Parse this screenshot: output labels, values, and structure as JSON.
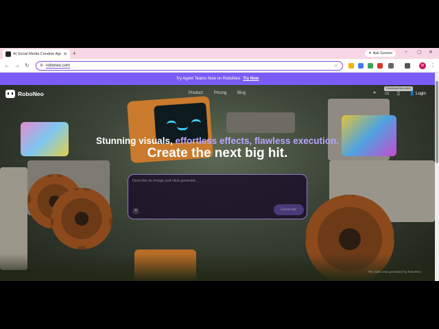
{
  "browser": {
    "tab_title": "AI Social Media Creative Agent",
    "ask_label": "Ask Gemini",
    "url": "roboneo.com",
    "avatar_letter": "M"
  },
  "banner": {
    "text": "Try Agent Teams Now on RoboNeo",
    "cta": "Try Now"
  },
  "site": {
    "logo": "RoboNeo",
    "nav": [
      "Product",
      "Pricing",
      "Blog"
    ],
    "login": "Login",
    "download_hint": "Download this video"
  },
  "hero": {
    "tagline_part1": "Stunning visuals, ",
    "tagline_part2": "effortless effects, flawless execution.",
    "headline": "Create the next big hit.",
    "prompt_placeholder": "Describe an image and click generate...",
    "generate_label": "Generate",
    "credit": "This video was generated by RoboNeo"
  },
  "colors": {
    "accent": "#7a5cf5",
    "highlight": "#b7a7ff"
  }
}
